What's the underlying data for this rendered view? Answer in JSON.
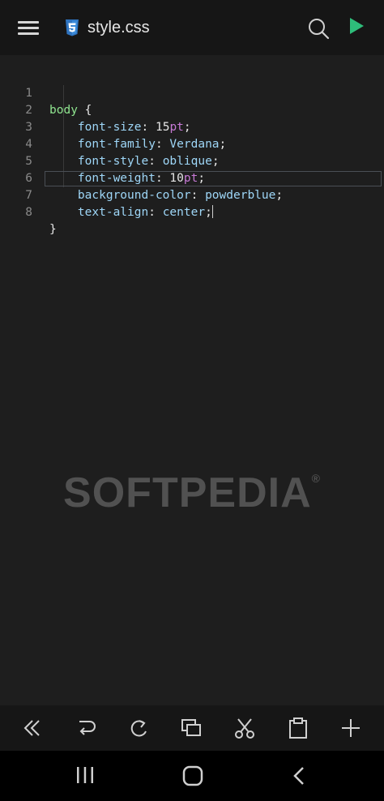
{
  "header": {
    "file_name": "style.css",
    "icons": [
      "menu-icon",
      "css3-file-icon",
      "search-icon",
      "run-icon"
    ]
  },
  "editor": {
    "lines": [
      {
        "number": "1",
        "text": "body {"
      },
      {
        "number": "2",
        "text": "    font-size: 15pt;"
      },
      {
        "number": "3",
        "text": "    font-family: Verdana;"
      },
      {
        "number": "4",
        "text": "    font-style: oblique;"
      },
      {
        "number": "5",
        "text": "    font-weight: 10pt;"
      },
      {
        "number": "6",
        "text": "    background-color: powderblue;"
      },
      {
        "number": "7",
        "text": "    text-align: center;"
      },
      {
        "number": "8",
        "text": "}"
      }
    ],
    "current_line": 7
  },
  "watermark": {
    "text": "SOFTPEDIA",
    "mark": "®"
  },
  "toolbar": {
    "tools": [
      "double-chevron-left-icon",
      "undo-icon",
      "redo-icon",
      "copy-icon",
      "cut-icon",
      "paste-icon",
      "add-icon"
    ]
  },
  "system_nav": {
    "buttons": [
      "recents-icon",
      "home-icon",
      "back-icon"
    ]
  },
  "colors": {
    "background": "#1e1e1e",
    "bar": "#161616",
    "selector": "#8fe38f",
    "property": "#9ed6f7",
    "unit": "#c77ad6",
    "run_accent": "#2ebd7a",
    "css_icon": "#2f74c0"
  }
}
